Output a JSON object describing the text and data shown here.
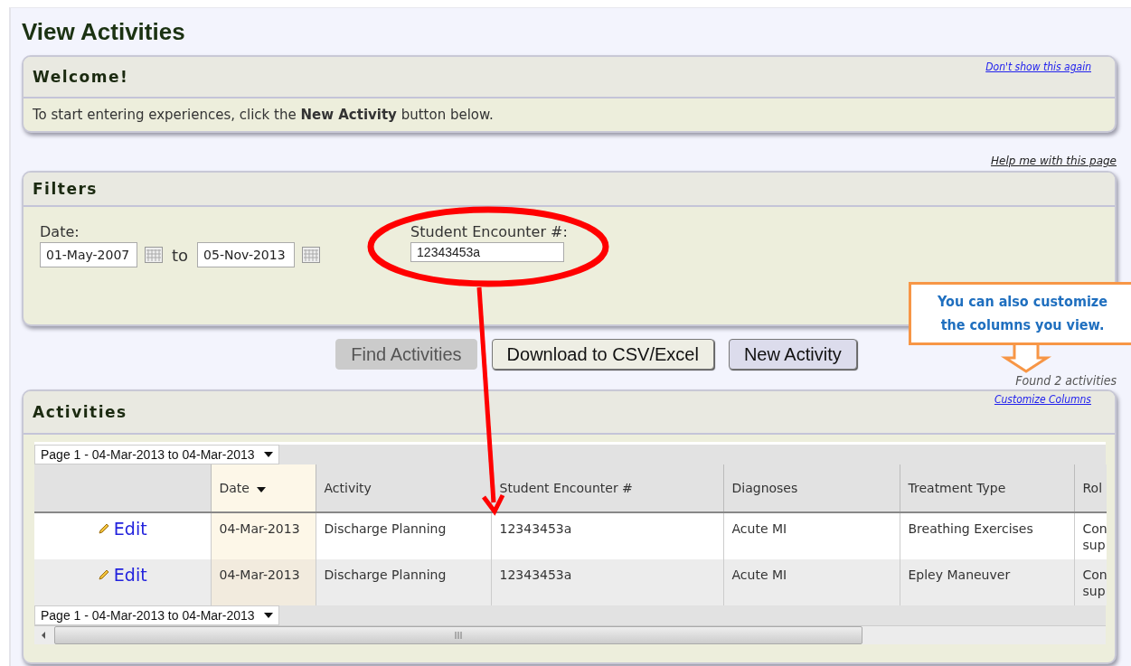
{
  "title": "View Activities",
  "welcome": {
    "heading": "Welcome!",
    "dismiss_link": "Don't show this again",
    "message": "To start entering experiences, click the **New Activity** button below."
  },
  "help_link": "Help me with this page",
  "filters": {
    "heading": "Filters",
    "date_label": "Date:",
    "date_from": "01-May-2007",
    "to_label": "to",
    "date_to": "05-Nov-2013",
    "encounter_label": "Student Encounter #:",
    "encounter_value": "12343453a"
  },
  "buttons": [
    {
      "label": "Find Activities",
      "kind": "plain",
      "disabled": true
    },
    {
      "label": "Download to CSV/Excel",
      "kind": "plain",
      "disabled": false
    },
    {
      "label": "New Activity",
      "kind": "accent",
      "disabled": false
    }
  ],
  "found_text": "Found 2 activities",
  "activities": {
    "heading": "Activities",
    "customize_link": "Customize Columns",
    "pager_top": "Page 1 - 04-Mar-2013 to 04-Mar-2013",
    "pager_bottom": "Page 1 - 04-Mar-2013 to 04-Mar-2013",
    "columns": [
      {
        "label": "Date",
        "sorted": true
      },
      {
        "label": "Activity",
        "sorted": false
      },
      {
        "label": "Student Encounter #",
        "sorted": false
      },
      {
        "label": "Diagnoses",
        "sorted": false
      },
      {
        "label": "Treatment Type",
        "sorted": false
      },
      {
        "label": "Rol",
        "sorted": false
      }
    ],
    "rows": [
      {
        "edit": "Edit",
        "cells": [
          "04-Mar-2013",
          "Discharge Planning",
          "12343453a",
          "Acute MI",
          "Breathing Exercises",
          "Con sup"
        ]
      },
      {
        "edit": "Edit",
        "cells": [
          "04-Mar-2013",
          "Discharge Planning",
          "12343453a",
          "Acute MI",
          "Epley Maneuver",
          "Con sup"
        ]
      }
    ]
  },
  "callout": "You can also customize the columns you view."
}
